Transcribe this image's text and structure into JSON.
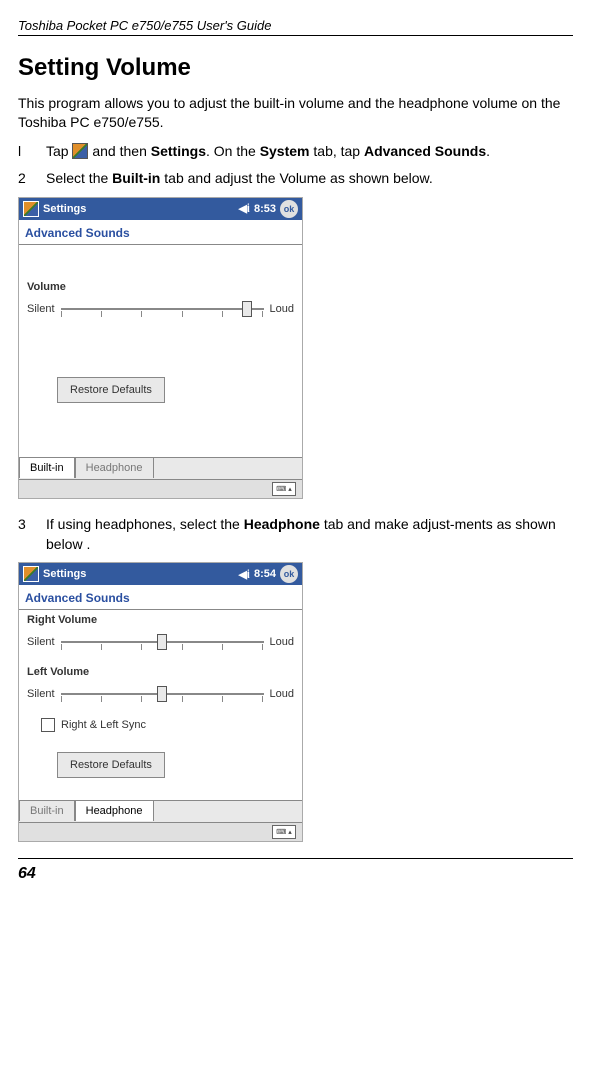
{
  "header": "Toshiba Pocket PC e750/e755  User's Guide",
  "title": "Setting Volume",
  "intro": "This program allows you to adjust the built-in volume and the headphone volume on the Toshiba PC e750/e755.",
  "step1": {
    "num": "l",
    "pre": "Tap ",
    "mid": " and then ",
    "settings": "Settings",
    "on": ". On the ",
    "system": "System",
    "tap": " tab, tap ",
    "adv": "Advanced Sounds",
    "end": "."
  },
  "step2": {
    "num": "2",
    "pre": "Select the ",
    "builtin": "Built-in",
    "post": " tab and adjust the Volume as shown below."
  },
  "step3": {
    "num": "3",
    "pre": "If using headphones, select the ",
    "headphone": "Headphone",
    "post": " tab and make adjust-ments as shown below ."
  },
  "shot1": {
    "title": "Settings",
    "time": "8:53",
    "ok": "ok",
    "section": "Advanced Sounds",
    "volume_label": "Volume",
    "silent": "Silent",
    "loud": "Loud",
    "restore": "Restore Defaults",
    "tab_builtin": "Built-in",
    "tab_headphone": "Headphone"
  },
  "shot2": {
    "title": "Settings",
    "time": "8:54",
    "ok": "ok",
    "section": "Advanced Sounds",
    "right_label": "Right Volume",
    "left_label": "Left Volume",
    "silent": "Silent",
    "loud": "Loud",
    "sync": "Right & Left Sync",
    "restore": "Restore Defaults",
    "tab_builtin": "Built-in",
    "tab_headphone": "Headphone"
  },
  "page_num": "64"
}
